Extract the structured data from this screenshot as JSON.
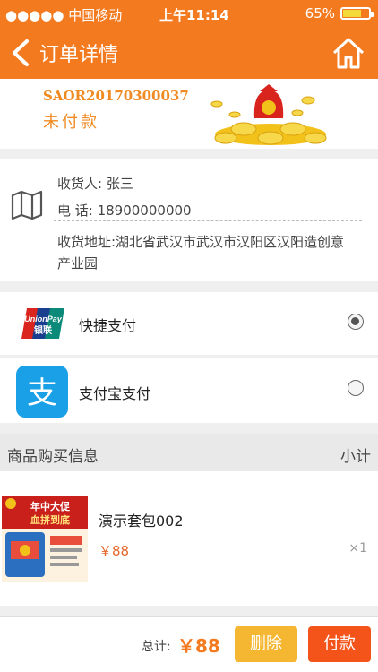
{
  "status_bar": {
    "carrier": "●●●●● 中国移动",
    "time": "上午11:14",
    "battery": "65%",
    "battery_level": 0.65
  },
  "header": {
    "title": "订单详情"
  },
  "order": {
    "number": "SAOR20170300037",
    "status": "未付款"
  },
  "address": {
    "recipient": "收货人: 张三",
    "phone": "电   话: 18900000000",
    "address": "收货地址:湖北省武汉市武汉市汉阳区汉阳造创意产业园"
  },
  "payment": {
    "options": [
      {
        "label": "快捷支付",
        "selected": true,
        "icon": "unionpay-icon"
      },
      {
        "label": "支付宝支付",
        "selected": false,
        "icon": "alipay-icon"
      }
    ]
  },
  "section": {
    "title": "商品购买信息",
    "subtotal_label": "小计"
  },
  "product": {
    "name": "演示套包002",
    "price": "￥88",
    "qty": "×1",
    "image_text_1": "年中大促",
    "image_text_2": "血拼到底"
  },
  "footer": {
    "total_label": "总计:",
    "total_value": "￥88",
    "delete_label": "删除",
    "pay_label": "付款"
  },
  "colors": {
    "brand": "#f47a20",
    "delete_button": "#f5b731",
    "pay_button": "#f4541a",
    "price": "#e3662a"
  }
}
